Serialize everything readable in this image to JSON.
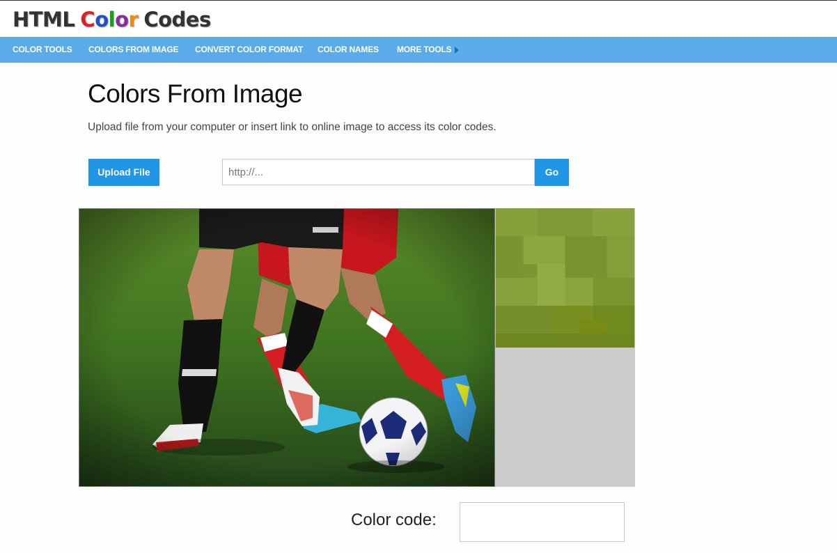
{
  "header": {
    "logo": {
      "part1": "HTML",
      "c": "C",
      "o1": "o",
      "l": "l",
      "o2": "o",
      "r": "r",
      "part3": "Codes"
    }
  },
  "nav": {
    "items": [
      {
        "label": "COLOR TOOLS"
      },
      {
        "label": "COLORS FROM IMAGE"
      },
      {
        "label": "CONVERT COLOR FORMAT"
      },
      {
        "label": "COLOR NAMES"
      },
      {
        "label": "MORE TOOLS"
      }
    ],
    "arrow_icon": "caret-right-icon"
  },
  "main": {
    "title": "Colors From Image",
    "description": "Upload file from your computer or insert link to online image to access its color codes.",
    "upload_button": "Upload File",
    "url_placeholder": "http://...",
    "go_button": "Go",
    "color_code_label": "Color code:",
    "color_code_value": ""
  },
  "colors": {
    "navbar": "#5aabe8",
    "button": "#2196e6",
    "swatch": "#cccccc"
  }
}
